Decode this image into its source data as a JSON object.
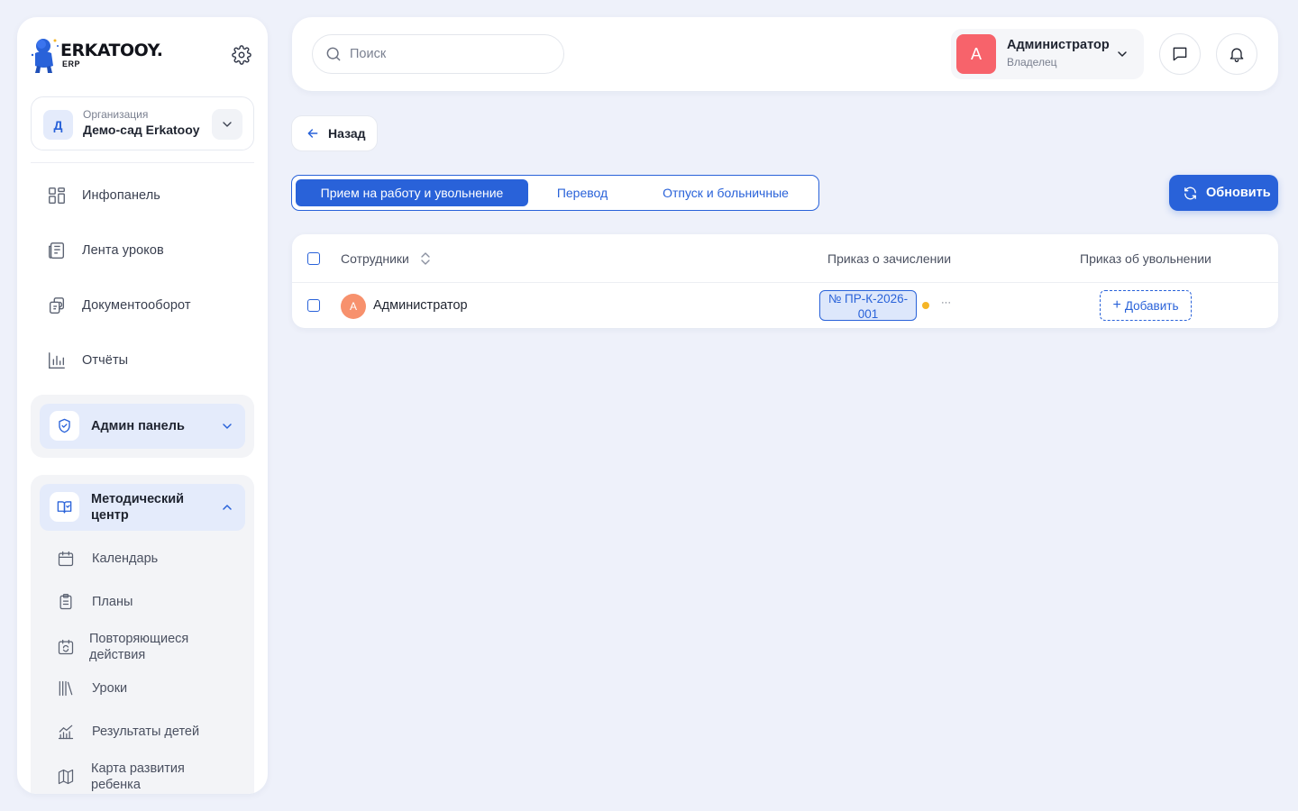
{
  "brand": {
    "name": "ERKATOOY.",
    "sub": "ERP"
  },
  "org": {
    "label": "Организация",
    "name": "Демо-сад Erkatooy",
    "initial": "Д"
  },
  "nav": [
    {
      "label": "Инфопанель",
      "icon": "dashboard-icon"
    },
    {
      "label": "Лента уроков",
      "icon": "newspaper-icon"
    },
    {
      "label": "Документооборот",
      "icon": "documents-icon"
    },
    {
      "label": "Отчёты",
      "icon": "chart-icon"
    }
  ],
  "admin_group": {
    "label": "Админ панель",
    "icon": "shield-icon",
    "expanded": false
  },
  "method_group": {
    "label_line1": "Методический",
    "label_line2": "центр",
    "icon": "book-icon",
    "expanded": true,
    "items": [
      {
        "label": "Календарь",
        "icon": "calendar-icon"
      },
      {
        "label": "Планы",
        "icon": "clipboard-icon"
      },
      {
        "label_line1": "Повторяющиеся",
        "label_line2": "действия",
        "icon": "recurring-icon"
      },
      {
        "label": "Уроки",
        "icon": "library-icon"
      },
      {
        "label": "Результаты детей",
        "icon": "trend-icon"
      },
      {
        "label_line1": "Карта развития",
        "label_line2": "ребенка",
        "icon": "map-icon"
      }
    ]
  },
  "search": {
    "placeholder": "Поиск",
    "value": ""
  },
  "user": {
    "name": "Администратор",
    "role": "Владелец",
    "initial": "А"
  },
  "back": {
    "label": "Назад"
  },
  "tabs": [
    {
      "label": "Прием на работу и увольнение",
      "active": true
    },
    {
      "label": "Перевод",
      "active": false
    },
    {
      "label": "Отпуск и больничные",
      "active": false
    }
  ],
  "refresh": {
    "label": "Обновить"
  },
  "table": {
    "columns": {
      "employees": "Сотрудники",
      "hire_order": "Приказ о зачислении",
      "dismissal_order": "Приказ об увольнении"
    },
    "rows": [
      {
        "initial": "А",
        "name": "Администратор",
        "hire_order_line1": "№ ПР-К-2026-",
        "hire_order_line2": "001",
        "more": "···",
        "add_label": "Добавить"
      }
    ]
  },
  "colors": {
    "accent": "#2962d9",
    "user_avatar": "#f7636b",
    "row_avatar": "#f7916d",
    "status_dot": "#f5b526"
  }
}
